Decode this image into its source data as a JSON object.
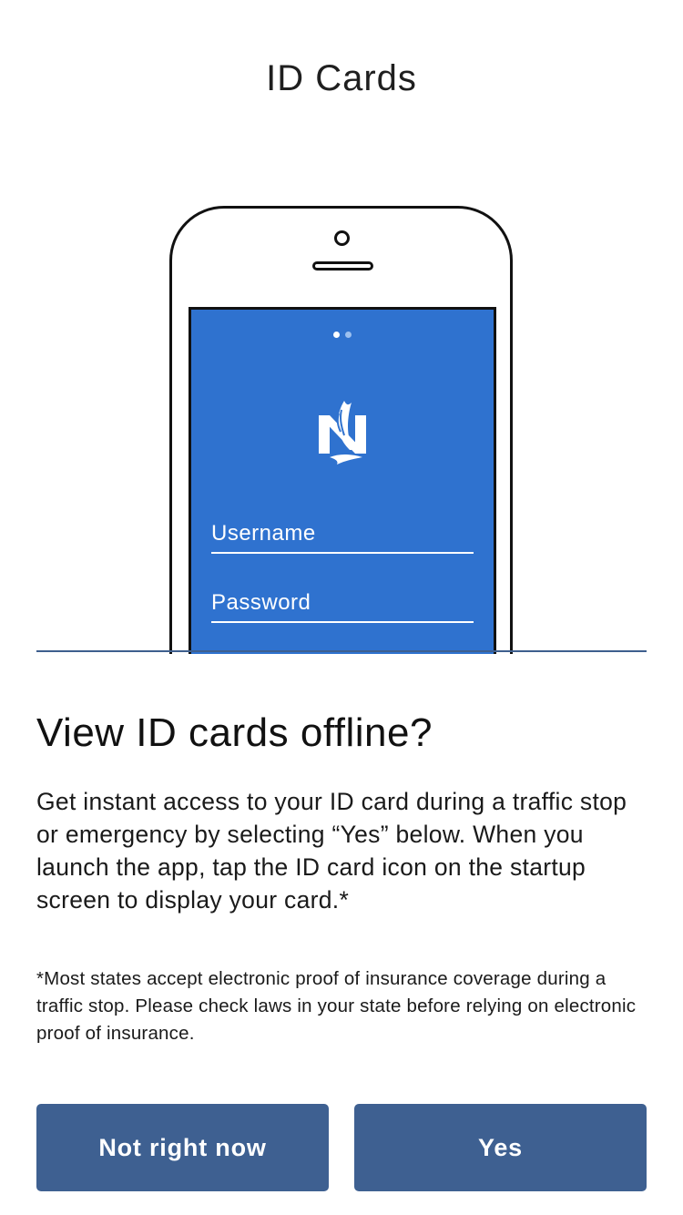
{
  "header": {
    "title": "ID Cards"
  },
  "illustration": {
    "screen_color": "#2f72cf",
    "page_indicator": {
      "total": 2,
      "active": 1
    },
    "logo_icon": "nationwide-eagle-logo-icon",
    "username_placeholder": "Username",
    "password_placeholder": "Password"
  },
  "content": {
    "heading": "View ID cards offline?",
    "body": "Get instant access to your ID card during a traffic stop or emergency by selecting “Yes” below. When you launch the app, tap the ID card icon on the startup screen to display your card.*",
    "footnote": "*Most states accept electronic proof of insurance coverage during a traffic stop. Please check laws in your state before relying on electronic proof of insurance."
  },
  "actions": {
    "not_now_label": "Not right now",
    "yes_label": "Yes",
    "button_color": "#3e6091"
  }
}
